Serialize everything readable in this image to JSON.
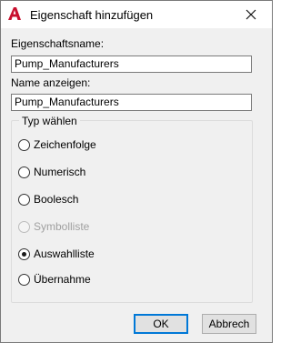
{
  "window": {
    "title": "Eigenschaft hinzufügen",
    "accent_color": "#c8102e"
  },
  "form": {
    "property_name_label": "Eigenschaftsname:",
    "property_name_value": "Pump_Manufacturers",
    "display_name_label": "Name anzeigen:",
    "display_name_value": "Pump_Manufacturers"
  },
  "type_group": {
    "label": "Typ wählen",
    "options": [
      {
        "label": "Zeichenfolge",
        "checked": false,
        "disabled": false
      },
      {
        "label": "Numerisch",
        "checked": false,
        "disabled": false
      },
      {
        "label": "Boolesch",
        "checked": false,
        "disabled": false
      },
      {
        "label": "Symbolliste",
        "checked": false,
        "disabled": true
      },
      {
        "label": "Auswahlliste",
        "checked": true,
        "disabled": false
      },
      {
        "label": "Übernahme",
        "checked": false,
        "disabled": false
      }
    ]
  },
  "buttons": {
    "ok_label": "OK",
    "cancel_label": "Abbrech"
  }
}
